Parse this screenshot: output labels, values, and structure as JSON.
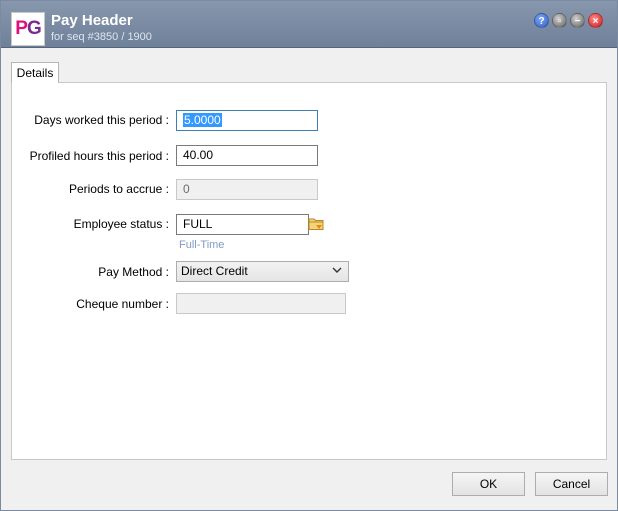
{
  "window": {
    "logo_text_p": "P",
    "logo_text_g": "G",
    "title": "Pay Header",
    "subtitle": "for seq #3850 / 1900"
  },
  "titlebar_buttons": {
    "help": "?",
    "restore": "▫",
    "minimize": "−",
    "close": "×"
  },
  "tabs": [
    {
      "label": "Details"
    }
  ],
  "form": {
    "days_worked": {
      "label": "Days worked this period :",
      "value": "5.0000"
    },
    "profiled_hours": {
      "label": "Profiled hours this period :",
      "value": "40.00"
    },
    "periods_accrue": {
      "label": "Periods to accrue :",
      "value": "0"
    },
    "employee_status": {
      "label": "Employee status :",
      "value": "FULL",
      "hint": "Full-Time"
    },
    "pay_method": {
      "label": "Pay Method :",
      "value": "Direct Credit"
    },
    "cheque_number": {
      "label": "Cheque number :",
      "value": ""
    }
  },
  "footer": {
    "ok_label": "OK",
    "cancel_label": "Cancel"
  }
}
